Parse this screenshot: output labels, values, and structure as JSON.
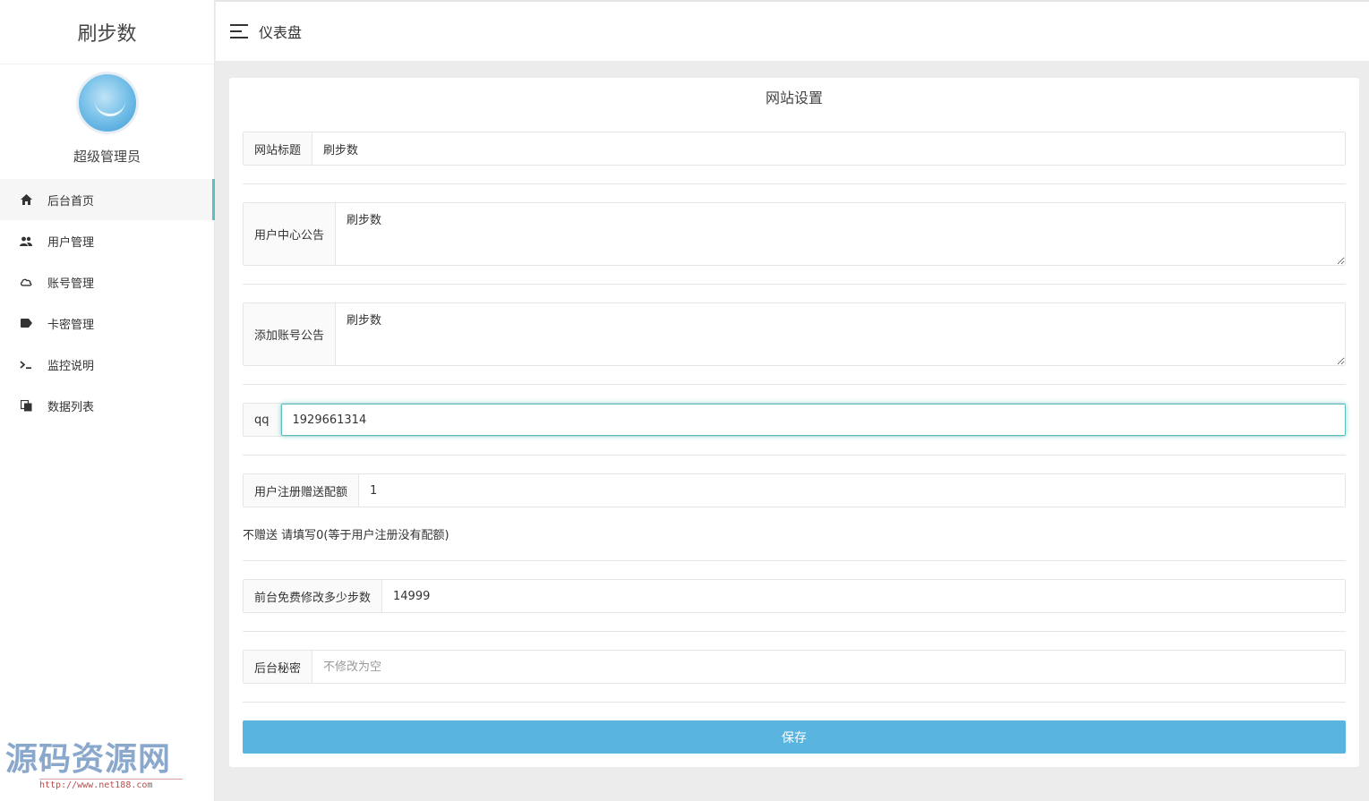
{
  "sidebar": {
    "brand": "刷步数",
    "role": "超级管理员",
    "items": [
      {
        "label": "后台首页",
        "icon": "home-icon"
      },
      {
        "label": "用户管理",
        "icon": "users-icon"
      },
      {
        "label": "账号管理",
        "icon": "cloud-icon"
      },
      {
        "label": "卡密管理",
        "icon": "tag-icon"
      },
      {
        "label": "监控说明",
        "icon": "terminal-icon"
      },
      {
        "label": "数据列表",
        "icon": "copy-icon"
      }
    ]
  },
  "topbar": {
    "title": "仪表盘",
    "menu_icon": "hamburger-icon"
  },
  "form": {
    "title": "网站设置",
    "site_title": {
      "label": "网站标题",
      "value": "刷步数"
    },
    "user_notice": {
      "label": "用户中心公告",
      "value": "刷步数"
    },
    "add_account_notice": {
      "label": "添加账号公告",
      "value": "刷步数"
    },
    "qq": {
      "label": "qq",
      "value": "1929661314"
    },
    "register_quota": {
      "label": "用户注册赠送配额",
      "value": "1",
      "help": "不赠送 请填写0(等于用户注册没有配额)"
    },
    "free_steps": {
      "label": "前台免费修改多少步数",
      "value": "14999"
    },
    "admin_password": {
      "label": "后台秘密",
      "placeholder": "不修改为空",
      "value": ""
    },
    "save_label": "保存"
  },
  "watermark": {
    "title": "源码资源网",
    "url": "http://www.net188.com"
  },
  "colors": {
    "accent": "#5bc0be",
    "button": "#5ab4e0",
    "background": "#ececec"
  }
}
